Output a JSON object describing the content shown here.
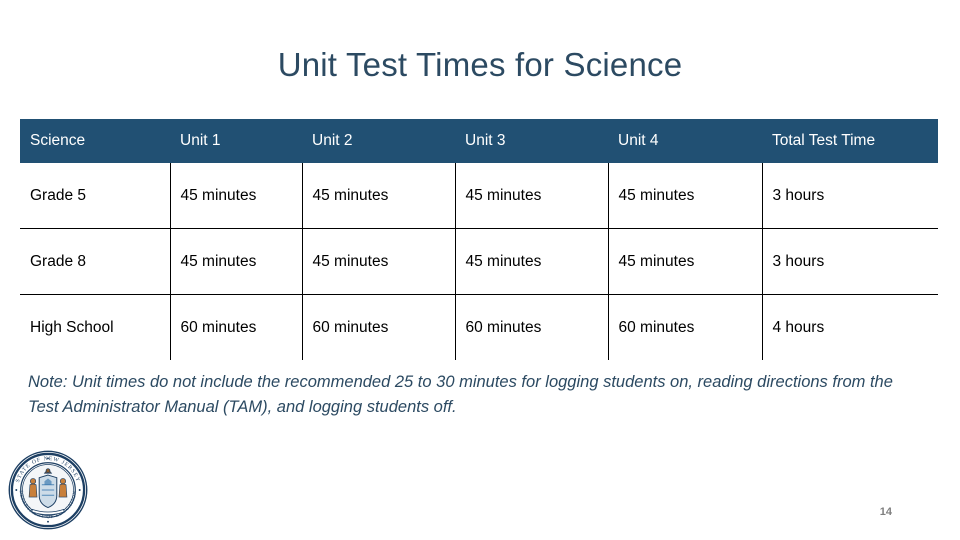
{
  "slide": {
    "title": "Unit Test Times for Science",
    "page_number": "14",
    "accent_header_color": "#215073",
    "title_color": "#2C4A62",
    "note_color": "#2C4A62"
  },
  "table": {
    "headers": [
      "Science",
      "Unit 1",
      "Unit 2",
      "Unit 3",
      "Unit 4",
      "Total Test Time"
    ],
    "rows": [
      {
        "label": "Grade 5",
        "unit1": "45 minutes",
        "unit2": "45 minutes",
        "unit3": "45 minutes",
        "unit4": "45 minutes",
        "total": "3 hours"
      },
      {
        "label": "Grade 8",
        "unit1": "45 minutes",
        "unit2": "45 minutes",
        "unit3": "45 minutes",
        "unit4": "45 minutes",
        "total": "3 hours"
      },
      {
        "label": "High School",
        "unit1": "60 minutes",
        "unit2": "60 minutes",
        "unit3": "60 minutes",
        "unit4": "60 minutes",
        "total": "4 hours"
      }
    ]
  },
  "note": {
    "text": "Note: Unit times do not include the recommended 25 to 30 minutes for logging students on, reading directions from the Test Administrator Manual (TAM), and logging students off."
  },
  "logo": {
    "name": "nj-department-of-education-seal",
    "outer_text_top": "STATE OF NEW JERSEY",
    "outer_text_bottom": "DEPARTMENT OF EDUCATION"
  }
}
